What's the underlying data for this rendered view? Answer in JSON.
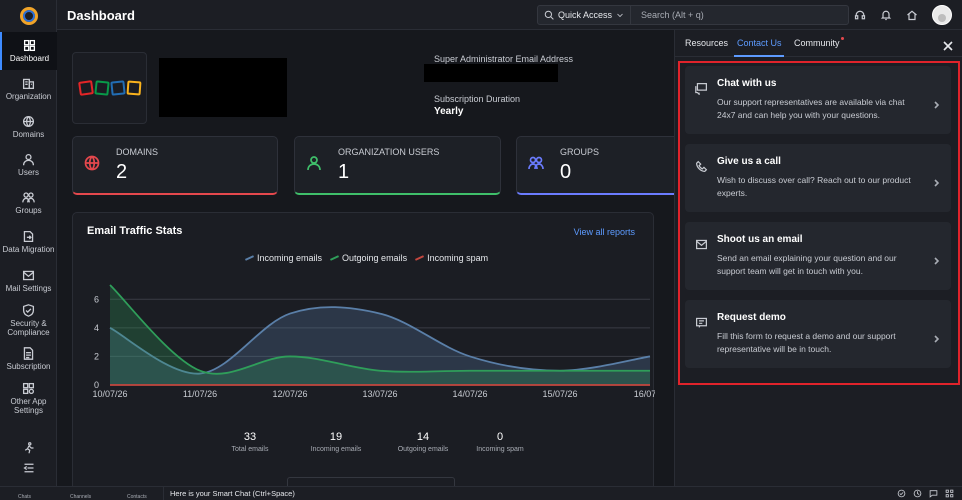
{
  "topbar": {
    "title": "Dashboard",
    "quick_access": "Quick Access",
    "search_placeholder": "Search (Alt + q)"
  },
  "sidebar": {
    "items": [
      {
        "label": "Dashboard",
        "icon": "grid-icon"
      },
      {
        "label": "Organization",
        "icon": "building-icon"
      },
      {
        "label": "Domains",
        "icon": "globe-icon"
      },
      {
        "label": "Users",
        "icon": "user-icon"
      },
      {
        "label": "Groups",
        "icon": "groups-icon"
      },
      {
        "label": "Data Migration",
        "icon": "migration-icon"
      },
      {
        "label": "Mail Settings",
        "icon": "mail-settings-icon"
      },
      {
        "label": "Security & Compliance",
        "icon": "shield-icon"
      },
      {
        "label": "Subscription",
        "icon": "document-icon"
      },
      {
        "label": "Other App Settings",
        "icon": "apps-icon"
      }
    ]
  },
  "org": {
    "super_admin_label": "Super Administrator Email Address",
    "subscription_label": "Subscription Duration",
    "subscription_value": "Yearly"
  },
  "stats": [
    {
      "label": "DOMAINS",
      "value": "2",
      "color": "#e5484d"
    },
    {
      "label": "ORGANIZATION USERS",
      "value": "1",
      "color": "#3fbf6a"
    },
    {
      "label": "GROUPS",
      "value": "0",
      "color": "#6b7cff"
    }
  ],
  "traffic": {
    "title": "Email Traffic Stats",
    "view_all": "View all reports",
    "totals": [
      {
        "value": "33",
        "label": "Total emails"
      },
      {
        "value": "19",
        "label": "Incoming emails"
      },
      {
        "value": "14",
        "label": "Outgoing emails"
      },
      {
        "value": "0",
        "label": "Incoming spam"
      }
    ]
  },
  "chart_data": {
    "type": "area",
    "x": [
      "10/07/26",
      "11/07/26",
      "12/07/26",
      "13/07/26",
      "14/07/26",
      "15/07/26",
      "16/07/..."
    ],
    "series": [
      {
        "name": "Incoming emails",
        "color": "#5a7fa8",
        "values": [
          4,
          0.8,
          5,
          5,
          2,
          1,
          2
        ]
      },
      {
        "name": "Outgoing emails",
        "color": "#2f9e5a",
        "values": [
          7,
          1,
          2,
          1,
          1,
          1,
          1
        ]
      },
      {
        "name": "Incoming spam",
        "color": "#c4473f",
        "values": [
          0,
          0,
          0,
          0,
          0,
          0,
          0
        ]
      }
    ],
    "ylim": [
      0,
      7
    ],
    "yticks": [
      0,
      2,
      4,
      6
    ],
    "grid": true,
    "legend": "top"
  },
  "panel": {
    "tabs": [
      "Resources",
      "Contact Us",
      "Community"
    ],
    "active_tab": "Contact Us",
    "options": [
      {
        "title": "Chat with us",
        "desc": "Our support representatives are available via chat 24x7 and can help you with your questions.",
        "icon": "chat-icon"
      },
      {
        "title": "Give us a call",
        "desc": "Wish to discuss over call? Reach out to our product experts.",
        "icon": "phone-icon"
      },
      {
        "title": "Shoot us an email",
        "desc": "Send an email explaining your question and our support team will get in touch with you.",
        "icon": "email-icon"
      },
      {
        "title": "Request demo",
        "desc": "Fill this form to request a demo and our support representative will be in touch.",
        "icon": "demo-icon"
      }
    ]
  },
  "bottombar": {
    "items": [
      "Chats",
      "Channels",
      "Contacts"
    ],
    "smart_chat": "Here is your Smart Chat (Ctrl+Space)"
  }
}
